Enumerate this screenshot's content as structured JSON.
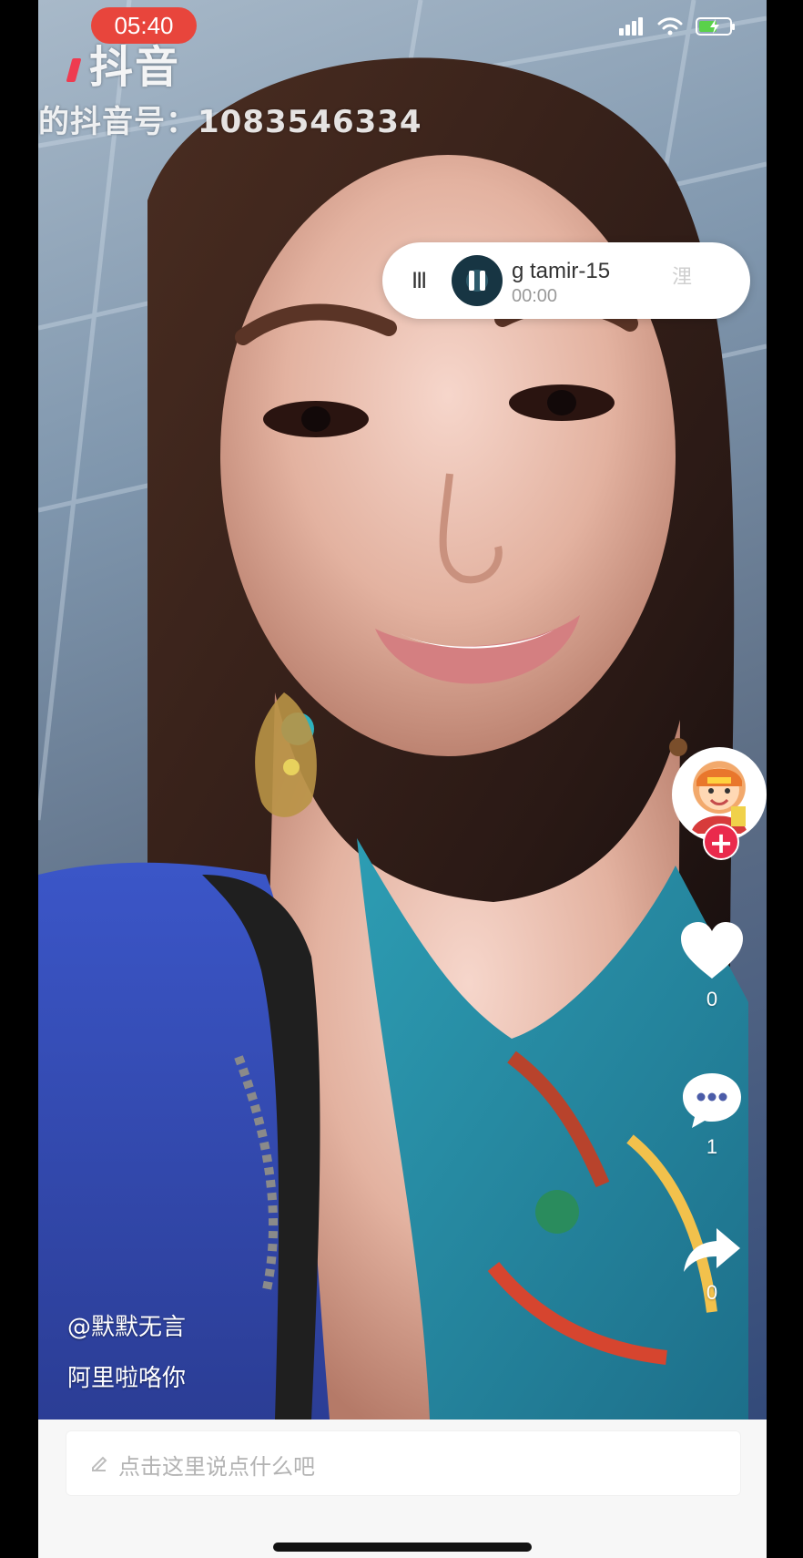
{
  "status_bar": {
    "time": "05:40",
    "battery_level": 0.6
  },
  "watermark": {
    "logo_text": "抖音",
    "id_line": "的抖音号：1083546334"
  },
  "mini_player": {
    "title": "g tamir-15",
    "time": "00:00",
    "ghost_char": "浬"
  },
  "right_rail": {
    "follow_plus": "+",
    "like_count": "0",
    "comment_count": "1",
    "share_count": "0"
  },
  "caption": {
    "username": "@默默无言",
    "text": "阿里啦咯你"
  },
  "comment_input": {
    "placeholder": "点击这里说点什么吧"
  },
  "colors": {
    "accent_red": "#ea2a4c",
    "time_pill": "#e8453c",
    "battery_green": "#5ad14b"
  },
  "icons": [
    "signal-icon",
    "wifi-icon",
    "battery-icon",
    "drag-handle-icon",
    "pause-icon",
    "heart-icon",
    "comment-icon",
    "share-icon",
    "pencil-icon"
  ]
}
